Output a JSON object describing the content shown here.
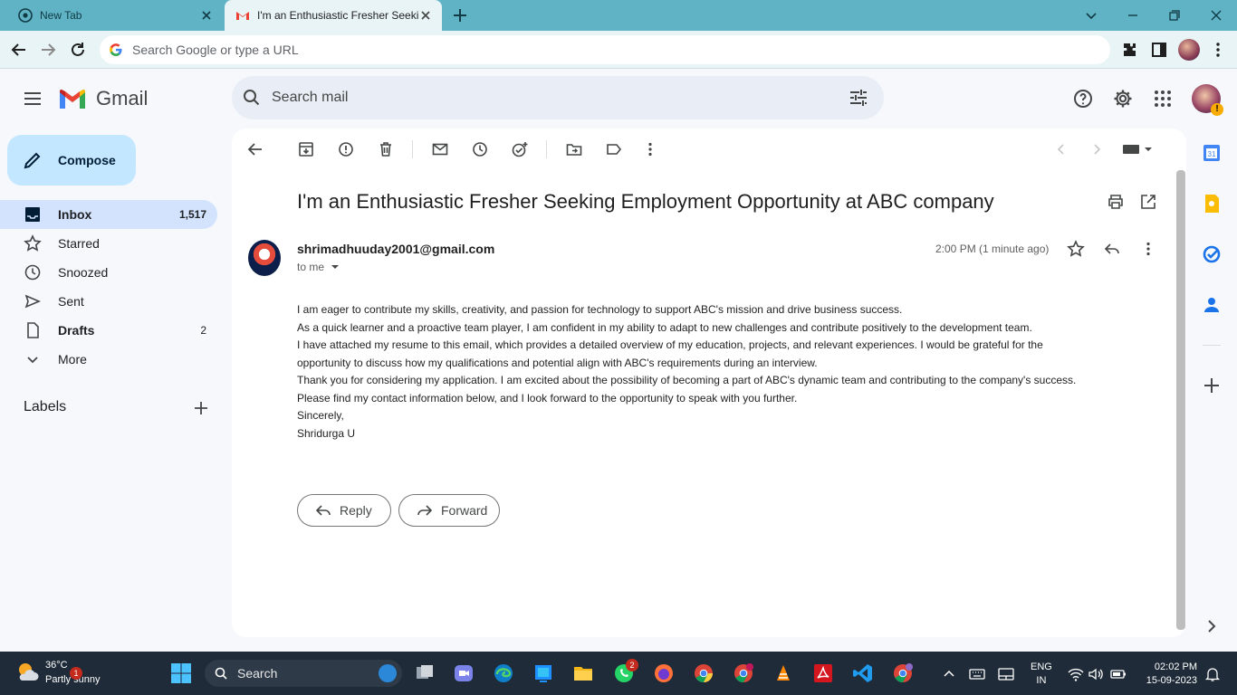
{
  "browser": {
    "tabs": [
      {
        "title": "New Tab"
      },
      {
        "title": "I'm an Enthusiastic Fresher Seeki"
      }
    ],
    "address_placeholder": "Search Google or type a URL"
  },
  "gmail": {
    "logo_text": "Gmail",
    "search_placeholder": "Search mail",
    "compose_label": "Compose",
    "nav": [
      {
        "label": "Inbox",
        "count": "1,517"
      },
      {
        "label": "Starred",
        "count": ""
      },
      {
        "label": "Snoozed",
        "count": ""
      },
      {
        "label": "Sent",
        "count": ""
      },
      {
        "label": "Drafts",
        "count": "2"
      },
      {
        "label": "More",
        "count": ""
      }
    ],
    "labels_heading": "Labels"
  },
  "email": {
    "subject": "I'm an Enthusiastic Fresher Seeking Employment Opportunity at ABC company",
    "sender": "shrimadhuuday2001@gmail.com",
    "to": "to me",
    "time": "2:00 PM (1 minute ago)",
    "body_lines": [
      "I am eager to contribute my skills, creativity, and passion for technology to support ABC's mission and drive business success.",
      "As a quick learner and a proactive team player, I am confident in my ability to adapt to new challenges and contribute positively to the development team.",
      "I have attached my resume to this email, which provides a detailed overview of my education, projects, and relevant experiences. I would be grateful for the",
      "opportunity to discuss how my qualifications and potential align with ABC's requirements during an interview.",
      "Thank you for considering my application. I am excited about the possibility of becoming a part of ABC's dynamic team and contributing to the company's success.",
      "Please find my contact information below, and I look forward to the opportunity to speak with you further.",
      "Sincerely,",
      "Shridurga U"
    ],
    "reply_label": "Reply",
    "forward_label": "Forward"
  },
  "taskbar": {
    "weather_temp": "36°C",
    "weather_condition": "Partly sunny",
    "weather_badge": "1",
    "search_label": "Search",
    "whatsapp_badge": "2",
    "lang_line1": "ENG",
    "lang_line2": "IN",
    "time": "02:02 PM",
    "date": "15-09-2023"
  },
  "colors": {
    "tabstrip": "#5fb3c4",
    "compose_bg": "#c2e7ff",
    "selected_nav": "#d3e3fd",
    "taskbar": "#1f2b38"
  }
}
